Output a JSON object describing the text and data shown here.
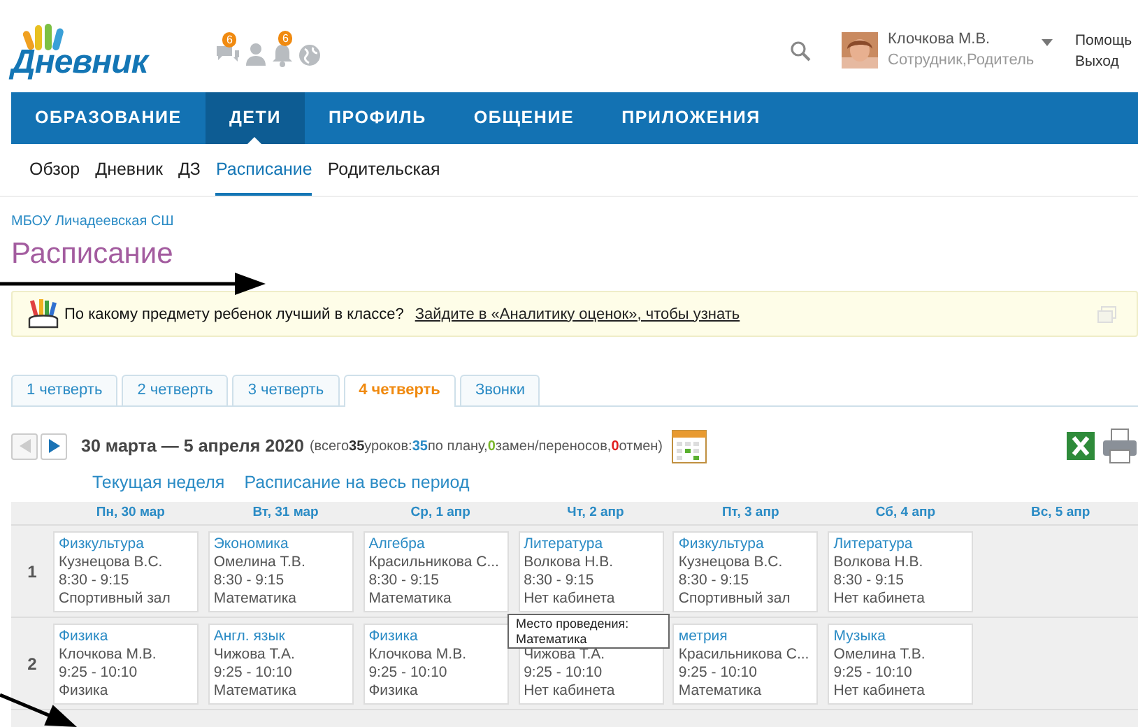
{
  "header": {
    "logo": "Дневник",
    "icons": [
      {
        "kind": "messages",
        "count": "6"
      },
      {
        "kind": "people"
      },
      {
        "kind": "bell",
        "count": "6"
      },
      {
        "kind": "globe"
      }
    ],
    "user": {
      "name": "Клочкова М.В.",
      "roles": "Сотрудник,Родитель"
    },
    "links": [
      "Помощь",
      "Выход"
    ]
  },
  "nav": [
    {
      "label": "ОБРАЗОВАНИЕ",
      "selected": false
    },
    {
      "label": "ДЕТИ",
      "selected": true
    },
    {
      "label": "ПРОФИЛЬ",
      "selected": false
    },
    {
      "label": "ОБЩЕНИЕ",
      "selected": false
    },
    {
      "label": "ПРИЛОЖЕНИЯ",
      "selected": false
    }
  ],
  "subnav": [
    {
      "label": "Обзор",
      "selected": false
    },
    {
      "label": "Дневник",
      "selected": false
    },
    {
      "label": "ДЗ",
      "selected": false
    },
    {
      "label": "Расписание",
      "selected": true
    },
    {
      "label": "Родительская",
      "selected": false
    }
  ],
  "breadcrumb": "МБОУ Личадеевская СШ",
  "title": "Расписание",
  "banner": {
    "question": "По какому предмету ребенок лучший в классе?",
    "link": "Зайдите в «Аналитику оценок», чтобы узнать"
  },
  "tabs": [
    {
      "label": "1 четверть",
      "selected": false
    },
    {
      "label": "2 четверть",
      "selected": false
    },
    {
      "label": "3 четверть",
      "selected": false
    },
    {
      "label": "4 четверть",
      "selected": true
    },
    {
      "label": "Звонки",
      "selected": false
    }
  ],
  "week": {
    "prev_disabled": true,
    "range": "30 марта — 5 апреля 2020",
    "summary": [
      {
        "kind": "plain",
        "text": "(всего"
      },
      {
        "kind": "total",
        "text": "35"
      },
      {
        "kind": "plain",
        "text": "уроков:"
      },
      {
        "kind": "planned",
        "text": "35"
      },
      {
        "kind": "plain",
        "text": "по плану,"
      },
      {
        "kind": "changes",
        "text": "0"
      },
      {
        "kind": "plain",
        "text": "замен/переносов,"
      },
      {
        "kind": "cancels",
        "text": "0"
      },
      {
        "kind": "plain",
        "text": "отмен)"
      }
    ]
  },
  "period_links": [
    "Текущая неделя",
    "Расписание на весь период"
  ],
  "days": [
    "Пн, 30 мар",
    "Вт, 31 мар",
    "Ср, 1 апр",
    "Чт, 2 апр",
    "Пт, 3 апр",
    "Сб, 4 апр",
    "Вс, 5 апр"
  ],
  "rows": [
    {
      "number": "1",
      "lessons": [
        {
          "subject": "Физкультура",
          "teacher": "Кузнецова В.С.",
          "time": "8:30 - 9:15",
          "room": "Спортивный зал"
        },
        {
          "subject": "Экономика",
          "teacher": "Омелина Т.В.",
          "time": "8:30 - 9:15",
          "room": "Математика"
        },
        {
          "subject": "Алгебра",
          "teacher": "Красильникова С...",
          "time": "8:30 - 9:15",
          "room": "Математика"
        },
        {
          "subject": "Литература",
          "teacher": "Волкова Н.В.",
          "time": "8:30 - 9:15",
          "room": "Нет кабинета"
        },
        {
          "subject": "Физкультура",
          "teacher": "Кузнецова В.С.",
          "time": "8:30 - 9:15",
          "room": "Спортивный зал"
        },
        {
          "subject": "Литература",
          "teacher": "Волкова Н.В.",
          "time": "8:30 - 9:15",
          "room": "Нет кабинета"
        }
      ]
    },
    {
      "number": "2",
      "lessons": [
        {
          "subject": "Физика",
          "teacher": "Клочкова М.В.",
          "time": "9:25 - 10:10",
          "room": "Физика"
        },
        {
          "subject": "Англ. язык",
          "teacher": "Чижова Т.А.",
          "time": "9:25 - 10:10",
          "room": "Математика"
        },
        {
          "subject": "Физика",
          "teacher": "Клочкова М.В.",
          "time": "9:25 - 10:10",
          "room": "Физика"
        },
        {
          "teacher": "Чижова Т.А.",
          "time": "9:25 - 10:10",
          "room": "Нет кабинета"
        },
        {
          "subject": "метрия",
          "teacher": "Красильникова С...",
          "time": "9:25 - 10:10",
          "room": "Математика"
        },
        {
          "subject": "Музыка",
          "teacher": "Омелина Т.В.",
          "time": "9:25 - 10:10",
          "room": "Нет кабинета"
        }
      ]
    }
  ],
  "tooltip": "Место проведения: Математика"
}
